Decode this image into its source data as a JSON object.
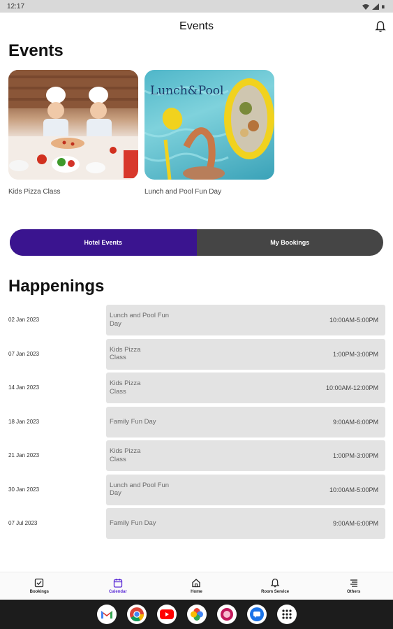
{
  "status_bar": {
    "time": "12:17"
  },
  "app_bar": {
    "title": "Events"
  },
  "events": {
    "title": "Events",
    "cards": [
      {
        "label": "Kids Pizza Class"
      },
      {
        "label": "Lunch and Pool Fun Day",
        "poster_text": "Lunch&Pool"
      }
    ]
  },
  "toggle": {
    "hotel_events": "Hotel Events",
    "my_bookings": "My Bookings",
    "selected": "Hotel Events"
  },
  "happenings": {
    "title": "Happenings",
    "items": [
      {
        "date": "02 Jan 2023",
        "name": "Lunch and Pool Fun Day",
        "time": "10:00AM-5:00PM"
      },
      {
        "date": "07 Jan 2023",
        "name": "Kids Pizza Class",
        "time": "1:00PM-3:00PM"
      },
      {
        "date": "14 Jan 2023",
        "name": "Kids Pizza Class",
        "time": "10:00AM-12:00PM"
      },
      {
        "date": "18 Jan 2023",
        "name": "Family Fun Day",
        "time": "9:00AM-6:00PM"
      },
      {
        "date": "21 Jan 2023",
        "name": "Kids Pizza Class",
        "time": "1:00PM-3:00PM"
      },
      {
        "date": "30 Jan 2023",
        "name": "Lunch and Pool Fun Day",
        "time": "10:00AM-5:00PM"
      },
      {
        "date": "07 Jul 2023",
        "name": "Family Fun Day",
        "time": "9:00AM-6:00PM"
      }
    ]
  },
  "bottom_nav": {
    "items": [
      {
        "label": "Bookings",
        "icon": "checkbox-icon"
      },
      {
        "label": "Calendar",
        "icon": "calendar-icon",
        "active": true
      },
      {
        "label": "Home",
        "icon": "home-icon"
      },
      {
        "label": "Room Service",
        "icon": "bell-icon"
      },
      {
        "label": "Others",
        "icon": "menu-icon"
      }
    ]
  },
  "dock": {
    "apps": [
      "gmail-icon",
      "chrome-icon",
      "youtube-icon",
      "photos-icon",
      "app-icon",
      "messages-icon",
      "app-drawer-icon"
    ]
  },
  "colors": {
    "accent": "#3a148f",
    "active_nav": "#5b2bd6",
    "toggle_inactive": "#454545",
    "row_bg": "#e3e3e3"
  }
}
